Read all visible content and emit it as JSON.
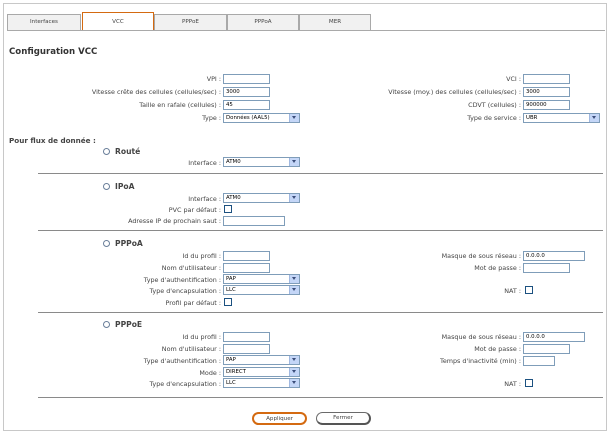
{
  "tabs": [
    "Interfaces",
    "VCC",
    "PPPoE",
    "PPPoA",
    "MER"
  ],
  "page_title": "Configuration VCC",
  "vcc": {
    "vpi_label": "VPI :",
    "vpi_value": "",
    "vci_label": "VCI :",
    "vci_value": "",
    "pcr_label": "Vitesse crête des cellules (cellules/sec) :",
    "pcr_value": "3000",
    "scr_label": "Vitesse (moy.) des cellules (cellules/sec) :",
    "scr_value": "3000",
    "mbs_label": "Taille en rafale (cellules) :",
    "mbs_value": "45",
    "cdvt_label": "CDVT (cellules) :",
    "cdvt_value": "900000",
    "type_label": "Type :",
    "type_value": "Données (AAL5)",
    "service_label": "Type de service :",
    "service_value": "UBR"
  },
  "flux_heading": "Pour flux de donnée :",
  "route": {
    "title": "Routé",
    "interface_label": "Interface :",
    "interface_value": "ATM0"
  },
  "ipoa": {
    "title": "IPoA",
    "interface_label": "Interface :",
    "interface_value": "ATM0",
    "default_pvc_label": "PVC par défaut :",
    "next_hop_label": "Adresse IP de prochain saut :",
    "next_hop_value": ""
  },
  "pppoa": {
    "title": "PPPoA",
    "profile_id_label": "Id du profil :",
    "profile_id_value": "",
    "username_label": "Nom d'utilisateur :",
    "username_value": "",
    "auth_label": "Type d'authentification :",
    "auth_value": "PAP",
    "encap_label": "Type d'encapsulation :",
    "encap_value": "LLC",
    "default_profile_label": "Profil par défaut :",
    "mask_label": "Masque de sous réseau :",
    "mask_value": "0.0.0.0",
    "password_label": "Mot de passe :",
    "password_value": "",
    "nat_label": "NAT :"
  },
  "pppoe": {
    "title": "PPPoE",
    "profile_id_label": "Id du profil :",
    "profile_id_value": "",
    "username_label": "Nom d'utilisateur :",
    "username_value": "",
    "auth_label": "Type d'authentification :",
    "auth_value": "PAP",
    "mode_label": "Mode :",
    "mode_value": "DIRECT",
    "encap_label": "Type d'encapsulation :",
    "encap_value": "LLC",
    "mask_label": "Masque de sous réseau :",
    "mask_value": "0.0.0.0",
    "password_label": "Mot de passe :",
    "password_value": "",
    "idle_label": "Temps d'inactivité (min) :",
    "idle_value": "",
    "nat_label": "NAT :"
  },
  "buttons": {
    "apply": "Appliquer",
    "close": "Fermer"
  },
  "colors": {
    "active_tab_border": "#d46a11",
    "input_border": "#7f9db9",
    "select_arrow": "#c4d6f7"
  }
}
